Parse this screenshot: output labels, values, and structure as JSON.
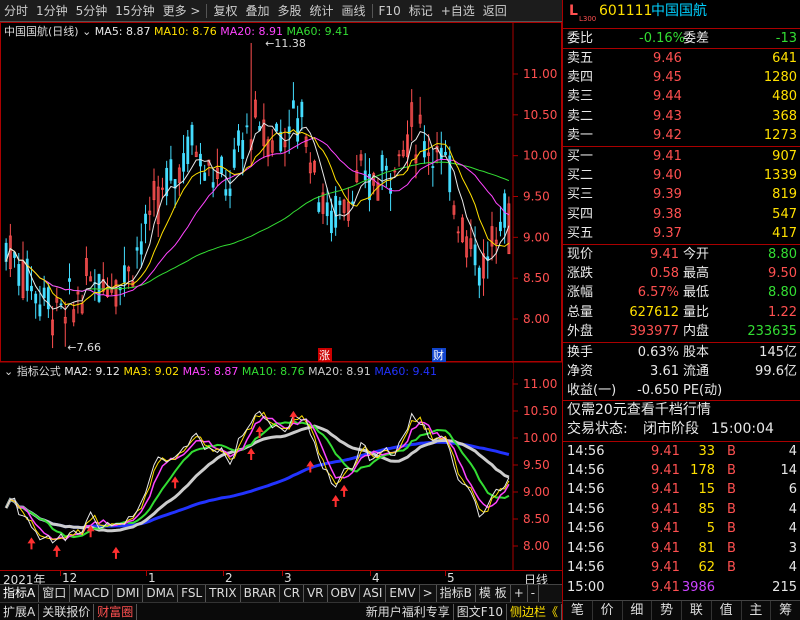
{
  "toolbar": {
    "items": [
      "分时",
      "1分钟",
      "5分钟",
      "15分钟",
      "更多 >",
      "复权",
      "叠加",
      "多股",
      "统计",
      "画线",
      "F10",
      "标记",
      "+自选",
      "返回"
    ]
  },
  "main_chart": {
    "title": "中国国航(日线)",
    "ma_labels": [
      {
        "text": "MA5: 8.87",
        "color": "#e8e8e8"
      },
      {
        "text": "MA10: 8.76",
        "color": "#ffe000"
      },
      {
        "text": "MA20: 8.91",
        "color": "#ff44ff"
      },
      {
        "text": "MA60: 9.41",
        "color": "#33dd33"
      }
    ],
    "y_ticks": [
      "11.00",
      "10.50",
      "10.00",
      "9.50",
      "9.00",
      "8.50",
      "8.00"
    ],
    "high_annotation": "11.38",
    "low_annotation": "7.66",
    "markers": {
      "zhang": "涨",
      "cai": "财"
    }
  },
  "indicator_chart": {
    "title": "指标公式",
    "ma_labels": [
      {
        "text": "MA2: 9.12",
        "color": "#e8e8e8"
      },
      {
        "text": "MA3: 9.02",
        "color": "#ffe000"
      },
      {
        "text": "MA5: 8.87",
        "color": "#ff44ff"
      },
      {
        "text": "MA10: 8.76",
        "color": "#33dd33"
      },
      {
        "text": "MA20: 8.91",
        "color": "#cccccc"
      },
      {
        "text": "MA60: 9.41",
        "color": "#2233ff"
      }
    ],
    "y_ticks": [
      "11.00",
      "10.50",
      "10.00",
      "9.50",
      "9.00",
      "8.50",
      "8.00"
    ]
  },
  "time_axis": {
    "labels": [
      "2021年",
      "12",
      "1",
      "2",
      "3",
      "4",
      "5"
    ],
    "period": "日线"
  },
  "bottom_tabs": [
    "指标A",
    "窗口",
    "MACD",
    "DMI",
    "DMA",
    "FSL",
    "TRIX",
    "BRAR",
    "CR",
    "VR",
    "OBV",
    "ASI",
    "EMV",
    ">",
    "指标B",
    "模 板",
    "+",
    "-"
  ],
  "status_bar": {
    "left": [
      "扩展A",
      "关联报价",
      "财富圈"
    ],
    "right": [
      "新用户福利专享",
      "图文F10",
      "侧边栏《"
    ]
  },
  "quote": {
    "code": "601111",
    "name": "中国国航",
    "market_tag": "L300",
    "weibi_label": "委比",
    "weibi_value": "-0.16%",
    "weicha_label": "委差",
    "weicha_value": "-13",
    "asks": [
      {
        "label": "卖五",
        "price": "9.46",
        "vol": "641"
      },
      {
        "label": "卖四",
        "price": "9.45",
        "vol": "1280"
      },
      {
        "label": "卖三",
        "price": "9.44",
        "vol": "480"
      },
      {
        "label": "卖二",
        "price": "9.43",
        "vol": "368"
      },
      {
        "label": "卖一",
        "price": "9.42",
        "vol": "1273"
      }
    ],
    "bids": [
      {
        "label": "买一",
        "price": "9.41",
        "vol": "907"
      },
      {
        "label": "买二",
        "price": "9.40",
        "vol": "1339"
      },
      {
        "label": "买三",
        "price": "9.39",
        "vol": "819"
      },
      {
        "label": "买四",
        "price": "9.38",
        "vol": "547"
      },
      {
        "label": "买五",
        "price": "9.37",
        "vol": "417"
      }
    ],
    "stats": [
      {
        "l1": "现价",
        "v1": "9.41",
        "c1": "#ff5050",
        "l2": "今开",
        "v2": "8.80",
        "c2": "#33dd33"
      },
      {
        "l1": "涨跌",
        "v1": "0.58",
        "c1": "#ff5050",
        "l2": "最高",
        "v2": "9.50",
        "c2": "#ff5050"
      },
      {
        "l1": "涨幅",
        "v1": "6.57%",
        "c1": "#ff5050",
        "l2": "最低",
        "v2": "8.80",
        "c2": "#33dd33"
      },
      {
        "l1": "总量",
        "v1": "627612",
        "c1": "#ffe000",
        "l2": "量比",
        "v2": "1.22",
        "c2": "#ff5050"
      },
      {
        "l1": "外盘",
        "v1": "393977",
        "c1": "#ff5050",
        "l2": "内盘",
        "v2": "233635",
        "c2": "#33dd33"
      }
    ],
    "finance": [
      {
        "l1": "换手",
        "v1": "0.63%",
        "l2": "股本",
        "v2": "145亿"
      },
      {
        "l1": "净资",
        "v1": "3.61",
        "l2": "流通",
        "v2": "99.6亿"
      },
      {
        "l1": "收益(一)",
        "v1": "-0.650",
        "l2": "PE(动)",
        "v2": ""
      }
    ],
    "promo": "仅需20元查看千档行情",
    "trade_status_label": "交易状态:",
    "trade_status": "闭市阶段",
    "trade_time": "15:00:04",
    "ticks": [
      {
        "time": "14:56",
        "price": "9.41",
        "vol": "33",
        "side": "B",
        "n": "4"
      },
      {
        "time": "14:56",
        "price": "9.41",
        "vol": "178",
        "side": "B",
        "n": "14"
      },
      {
        "time": "14:56",
        "price": "9.41",
        "vol": "15",
        "side": "B",
        "n": "6"
      },
      {
        "time": "14:56",
        "price": "9.41",
        "vol": "85",
        "side": "B",
        "n": "4"
      },
      {
        "time": "14:56",
        "price": "9.41",
        "vol": "5",
        "side": "B",
        "n": "4"
      },
      {
        "time": "14:56",
        "price": "9.41",
        "vol": "81",
        "side": "B",
        "n": "3"
      },
      {
        "time": "14:56",
        "price": "9.41",
        "vol": "62",
        "side": "B",
        "n": "4"
      },
      {
        "time": "15:00",
        "price": "9.41",
        "vol": "3986",
        "side": "",
        "n": "215"
      }
    ],
    "bottom_buttons": [
      "笔",
      "价",
      "细",
      "势",
      "联",
      "值",
      "主",
      "筹"
    ]
  },
  "colors": {
    "up": "#ff5050",
    "down": "#33dd33",
    "bg": "#000000",
    "border": "#aa0000"
  }
}
